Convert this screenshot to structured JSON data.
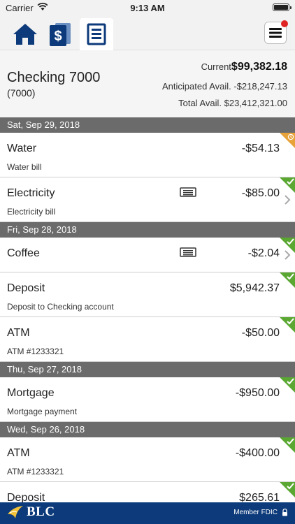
{
  "status": {
    "carrier": "Carrier",
    "time": "9:13 AM"
  },
  "nav": {
    "tabs": [
      {
        "icon": "home-icon"
      },
      {
        "icon": "dollar-icon"
      },
      {
        "icon": "document-list-icon",
        "active": true
      }
    ],
    "menu_icon": "hamburger-menu-icon"
  },
  "account": {
    "name": "Checking 7000",
    "number": "(7000)",
    "current_label": "Current",
    "current_value": "$99,382.18",
    "anticipated": "Anticipated Avail. -$218,247.13",
    "total": "Total Avail. $23,412,321.00"
  },
  "groups": [
    {
      "date": "Sat, Sep 29, 2018",
      "items": [
        {
          "title": "Water",
          "description": "Water bill",
          "amount": "-$54.13",
          "status": "pending"
        },
        {
          "title": "Electricity",
          "description": "Electricity bill",
          "amount": "-$85.00",
          "status": "cleared",
          "receipt": true,
          "chevron": true
        }
      ]
    },
    {
      "date": "Fri, Sep 28, 2018",
      "items": [
        {
          "title": "Coffee",
          "description": "",
          "amount": "-$2.04",
          "status": "cleared",
          "receipt": true,
          "chevron": true
        },
        {
          "title": "Deposit",
          "description": "Deposit to Checking account",
          "amount": "$5,942.37",
          "status": "cleared"
        },
        {
          "title": "ATM",
          "description": "ATM #1233321",
          "amount": "-$50.00",
          "status": "cleared"
        }
      ]
    },
    {
      "date": "Thu, Sep 27, 2018",
      "items": [
        {
          "title": "Mortgage",
          "description": "Mortgage payment",
          "amount": "-$950.00",
          "status": "cleared"
        }
      ]
    },
    {
      "date": "Wed, Sep 26, 2018",
      "items": [
        {
          "title": "ATM",
          "description": "ATM #1233321",
          "amount": "-$400.00",
          "status": "cleared"
        },
        {
          "title": "Deposit",
          "description": "",
          "amount": "$265.61",
          "status": "cleared"
        }
      ]
    }
  ],
  "footer": {
    "logo": "BLC",
    "fdic": "Member FDIC"
  },
  "colors": {
    "cleared": "#5aa832",
    "pending": "#e8a23a",
    "brand": "#0c3a7a",
    "header_gray": "#6b6b6b"
  }
}
